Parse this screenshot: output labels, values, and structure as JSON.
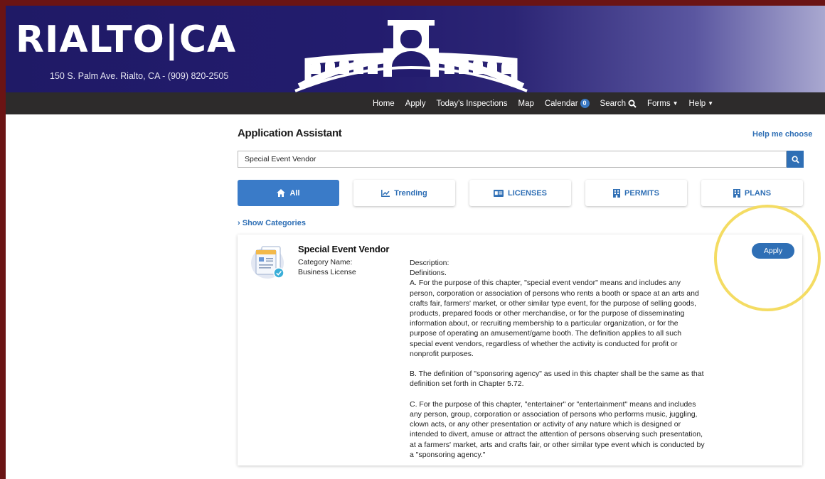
{
  "header": {
    "logo": "RIALTO|CA",
    "address": "150 S. Palm Ave. Rialto, CA - (909) 820-2505"
  },
  "nav": {
    "home": "Home",
    "apply": "Apply",
    "inspections": "Today's Inspections",
    "map": "Map",
    "calendar": "Calendar",
    "calendar_count": "0",
    "search": "Search",
    "forms": "Forms",
    "help": "Help"
  },
  "page": {
    "title": "Application Assistant",
    "help_link": "Help me choose",
    "search_value": "Special Event Vendor",
    "show_categories": "Show Categories"
  },
  "tabs": {
    "all": "All",
    "trending": "Trending",
    "licenses": "LICENSES",
    "permits": "PERMITS",
    "plans": "PLANS"
  },
  "result": {
    "title": "Special Event Vendor",
    "category_label": "Category Name:",
    "category_value": "Business License",
    "apply_label": "Apply",
    "description": {
      "label": "Description:",
      "heading": "Definitions.",
      "a": "A. For the purpose of this chapter, \"special event vendor\" means and includes any person, corporation or association of persons who rents a booth or space at an arts and crafts fair, farmers' market, or other similar type event, for the purpose of selling goods, products, prepared foods or other merchandise, or for the purpose of disseminating information about, or recruiting membership to a particular organization, or for the purpose of operating an amusement/game booth. The definition applies to all such special event vendors, regardless of whether the activity is conducted for profit or nonprofit purposes.",
      "b": "B. The definition of \"sponsoring agency\" as used in this chapter shall be the same as that definition set forth in Chapter 5.72.",
      "c": "C. For the purpose of this chapter, \"entertainer\" or \"entertainment\" means and includes any person, group, corporation or association of persons who performs music, juggling, clown acts, or any other presentation or activity of any nature which is designed or intended to divert, amuse or attract the attention of persons observing such presentation, at a farmers' market, arts and crafts fair, or other similar type event which is conducted by a \"sponsoring agency.\""
    }
  },
  "colors": {
    "header_dark": "#1f1a66",
    "nav_bar": "#2d2b2b",
    "accent_blue": "#2f6fb5",
    "active_tab": "#3a7bc8",
    "highlight_ring": "#f4dc63",
    "outer_frame": "#6b1414"
  },
  "icons": {
    "search": "search-icon",
    "home": "home-icon",
    "trending": "trending-chart-icon",
    "licenses": "id-card-icon",
    "permits": "building-icon",
    "plans": "building-icon",
    "result": "document-check-icon"
  }
}
